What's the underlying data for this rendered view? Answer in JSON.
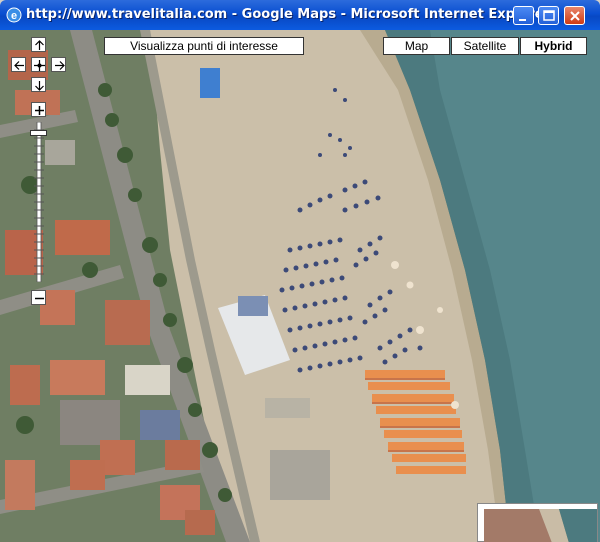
{
  "window": {
    "title": "http://www.travelitalia.com - Google Maps - Microsoft Internet Explorer"
  },
  "map": {
    "poi_button_label": "Visualizza punti di interesse",
    "map_types": [
      {
        "label": "Map",
        "selected": false
      },
      {
        "label": "Satellite",
        "selected": false
      },
      {
        "label": "Hybrid",
        "selected": true
      }
    ],
    "zoom_level_fraction": 0.95
  },
  "colors": {
    "titlebar": "#0a4fd1",
    "sea": "#4c7a7f",
    "sand": "#c9bca6",
    "umbrella_blue": "#3c4a78",
    "umbrella_orange": "#e98f4e"
  }
}
